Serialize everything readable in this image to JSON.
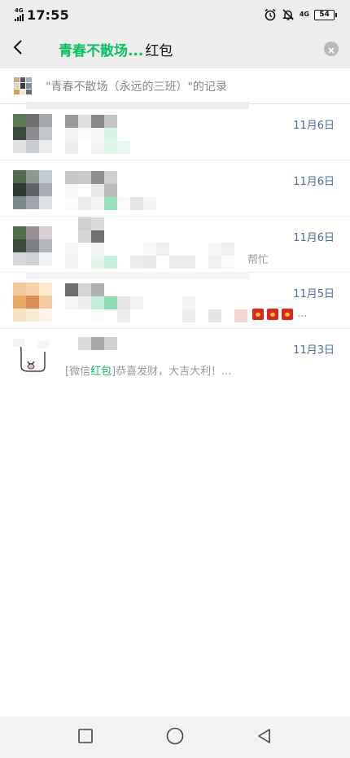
{
  "status_bar": {
    "network_badge": "4G",
    "time": "17:55",
    "net_type": "4G",
    "battery_level": "54",
    "icons": [
      "alarm-icon",
      "silent-bell-icon"
    ]
  },
  "search": {
    "group_name": "青春不散场...",
    "keyword": "红包",
    "icons": [
      "back-arrow-icon",
      "clear-icon"
    ]
  },
  "scope": {
    "text": "\"青春不散场（永远的三班）\"的记录"
  },
  "results": [
    {
      "date": "11月6日",
      "snippet_tail": ""
    },
    {
      "date": "11月6日",
      "snippet_tail": ""
    },
    {
      "date": "11月6日",
      "snippet_tail": "帮忙"
    },
    {
      "date": "11月5日",
      "snippet_tail": "..."
    },
    {
      "date": "11月3日",
      "snippet_prefix": "[微信",
      "snippet_highlight": "红包",
      "snippet_suffix": "]恭喜发财，大吉大利！..."
    }
  ],
  "colors": {
    "accent": "#07c160",
    "date": "#4a6b9a",
    "red_packet": "#d9281c"
  },
  "nav": {
    "icons": [
      "recents-square-icon",
      "home-circle-icon",
      "back-triangle-icon"
    ]
  }
}
